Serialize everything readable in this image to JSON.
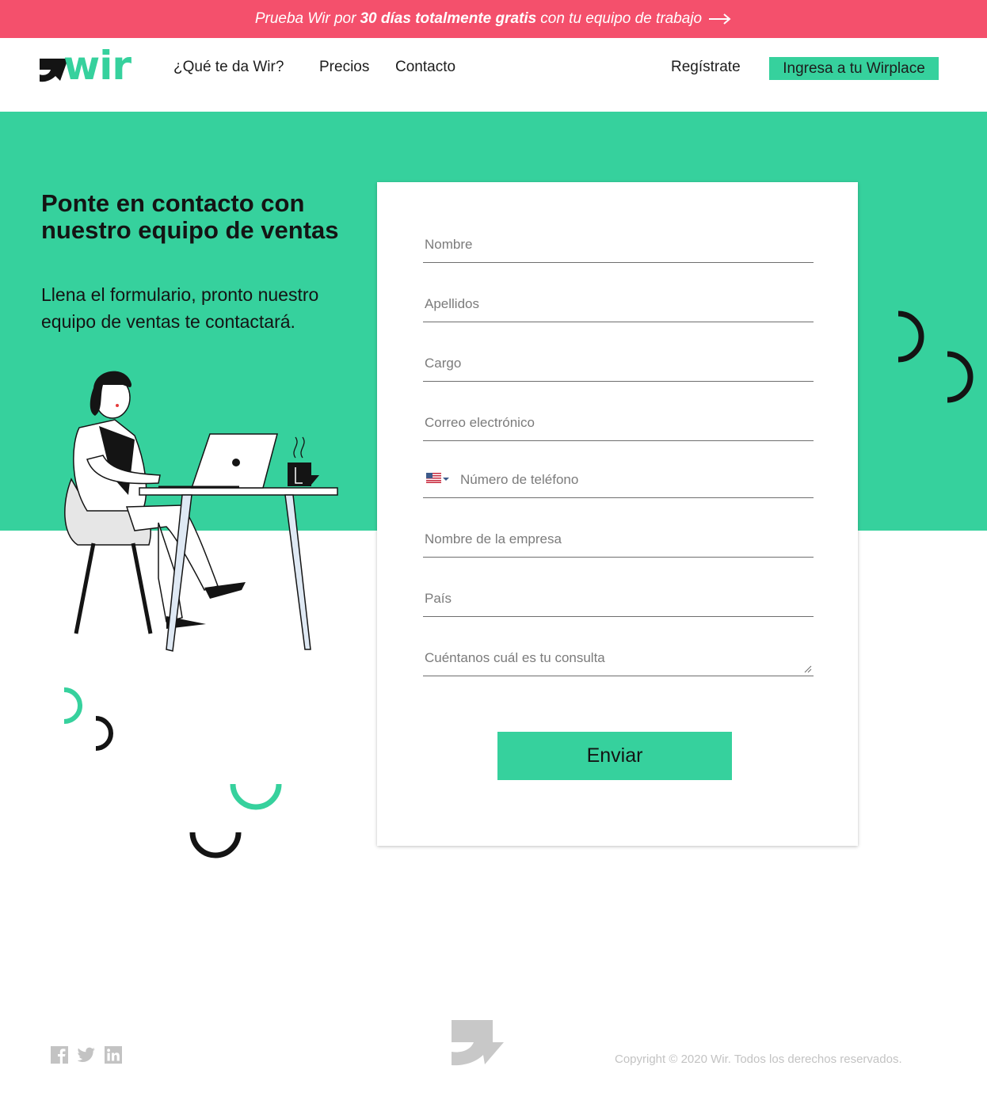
{
  "promo": {
    "prefix": "Prueba Wir por",
    "highlight": "30 días totalmente gratis",
    "suffix": "con tu equipo de trabajo",
    "arrow_icon": "arrow-right-icon"
  },
  "header": {
    "logo_text": "wir",
    "nav": [
      "¿Qué te da Wir?",
      "Precios",
      "Contacto"
    ],
    "register_label": "Regístrate",
    "login_label": "Ingresa a tu Wirplace"
  },
  "hero": {
    "title": "Ponte en contacto con nuestro equipo de ventas",
    "subtitle": "Llena el formulario, pronto nuestro equipo de ventas te contactará."
  },
  "form": {
    "fields": [
      {
        "placeholder": "Nombre"
      },
      {
        "placeholder": "Apellidos"
      },
      {
        "placeholder": "Cargo"
      },
      {
        "placeholder": "Correo electrónico"
      },
      {
        "placeholder": "Número de teléfono",
        "flag_icon": "us-flag-icon"
      },
      {
        "placeholder": "Nombre de la empresa"
      },
      {
        "placeholder": "País"
      },
      {
        "placeholder": "Cuéntanos  cuál es tu consulta"
      }
    ],
    "submit_label": "Enviar"
  },
  "footer": {
    "social_icons": [
      "facebook-icon",
      "twitter-icon",
      "linkedin-icon"
    ],
    "copyright": "Copyright © 2020 Wir. Todos los derechos reservados."
  },
  "colors": {
    "brand_green": "#36d19d",
    "promo_pink": "#f4506c",
    "dark": "#141414",
    "muted": "#c3c3c3"
  }
}
